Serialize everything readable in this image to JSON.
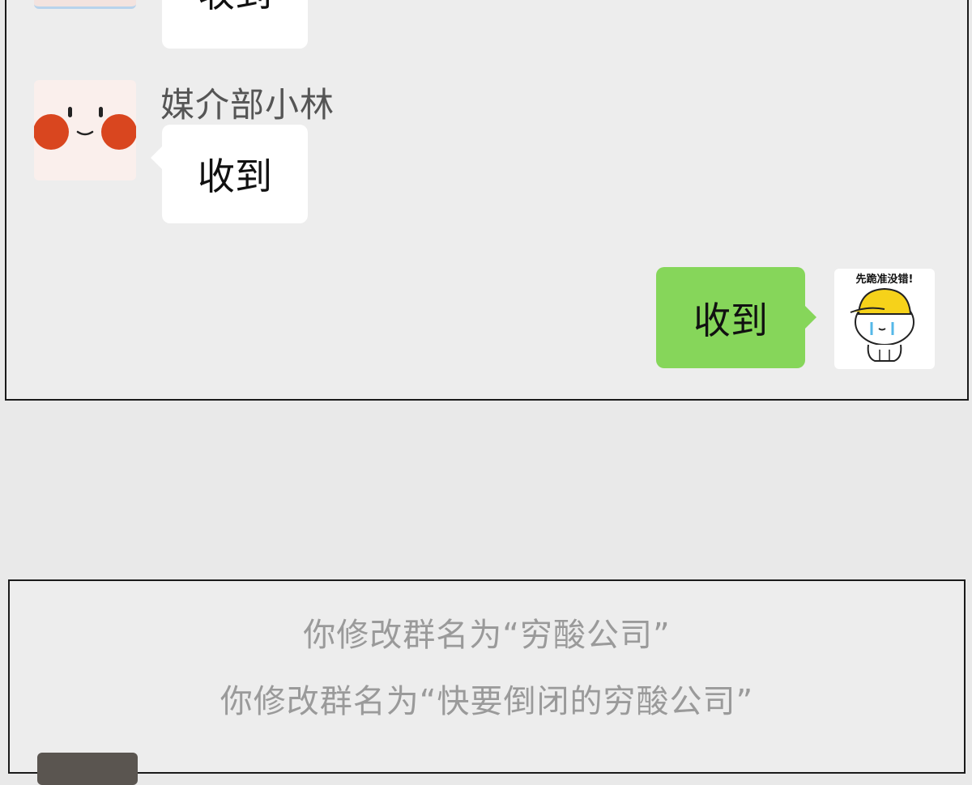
{
  "chat_top": {
    "messages": [
      {
        "sender": "",
        "text": "收到",
        "side": "left"
      },
      {
        "sender": "媒介部小林",
        "text": "收到",
        "side": "left"
      },
      {
        "sender": "",
        "text": "收到",
        "side": "right"
      }
    ],
    "self_avatar_caption": "先跪准没错!"
  },
  "chat_bottom": {
    "system_messages": [
      "你修改群名为“穷酸公司”",
      "你修改群名为“快要倒闭的穷酸公司”"
    ]
  },
  "colors": {
    "background": "#e9e9e9",
    "panel": "#ededed",
    "bubble_incoming": "#ffffff",
    "bubble_outgoing": "#86d65a",
    "system_text": "#9a9a9a",
    "blush": "#d9461f"
  },
  "icons": [
    "blush-face-avatar",
    "crying-hardhat-avatar"
  ]
}
